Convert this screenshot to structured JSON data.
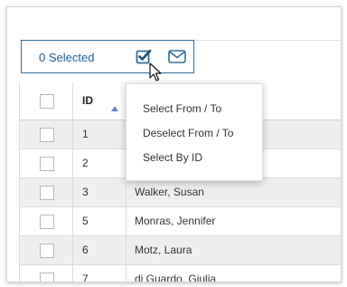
{
  "selection_bar": {
    "count_label": "0 Selected",
    "select_icon": "checkbox-check-icon",
    "email_icon": "envelope-icon"
  },
  "colors": {
    "accent": "#2e6f9e",
    "row_shade": "#efefef",
    "sort_arrow": "#6e7fd1"
  },
  "table": {
    "columns": [
      "",
      "ID",
      ""
    ],
    "sort": {
      "column": "ID",
      "direction": "ascending"
    },
    "rows": [
      {
        "id": "1",
        "name": ""
      },
      {
        "id": "2",
        "name": ""
      },
      {
        "id": "3",
        "name": "Walker, Susan"
      },
      {
        "id": "5",
        "name": "Monras, Jennifer"
      },
      {
        "id": "6",
        "name": "Motz, Laura"
      },
      {
        "id": "7",
        "name": "di Guardo, Giulia"
      }
    ]
  },
  "dropdown_menu": {
    "items": [
      "Select From / To",
      "Deselect From / To",
      "Select By ID"
    ]
  }
}
